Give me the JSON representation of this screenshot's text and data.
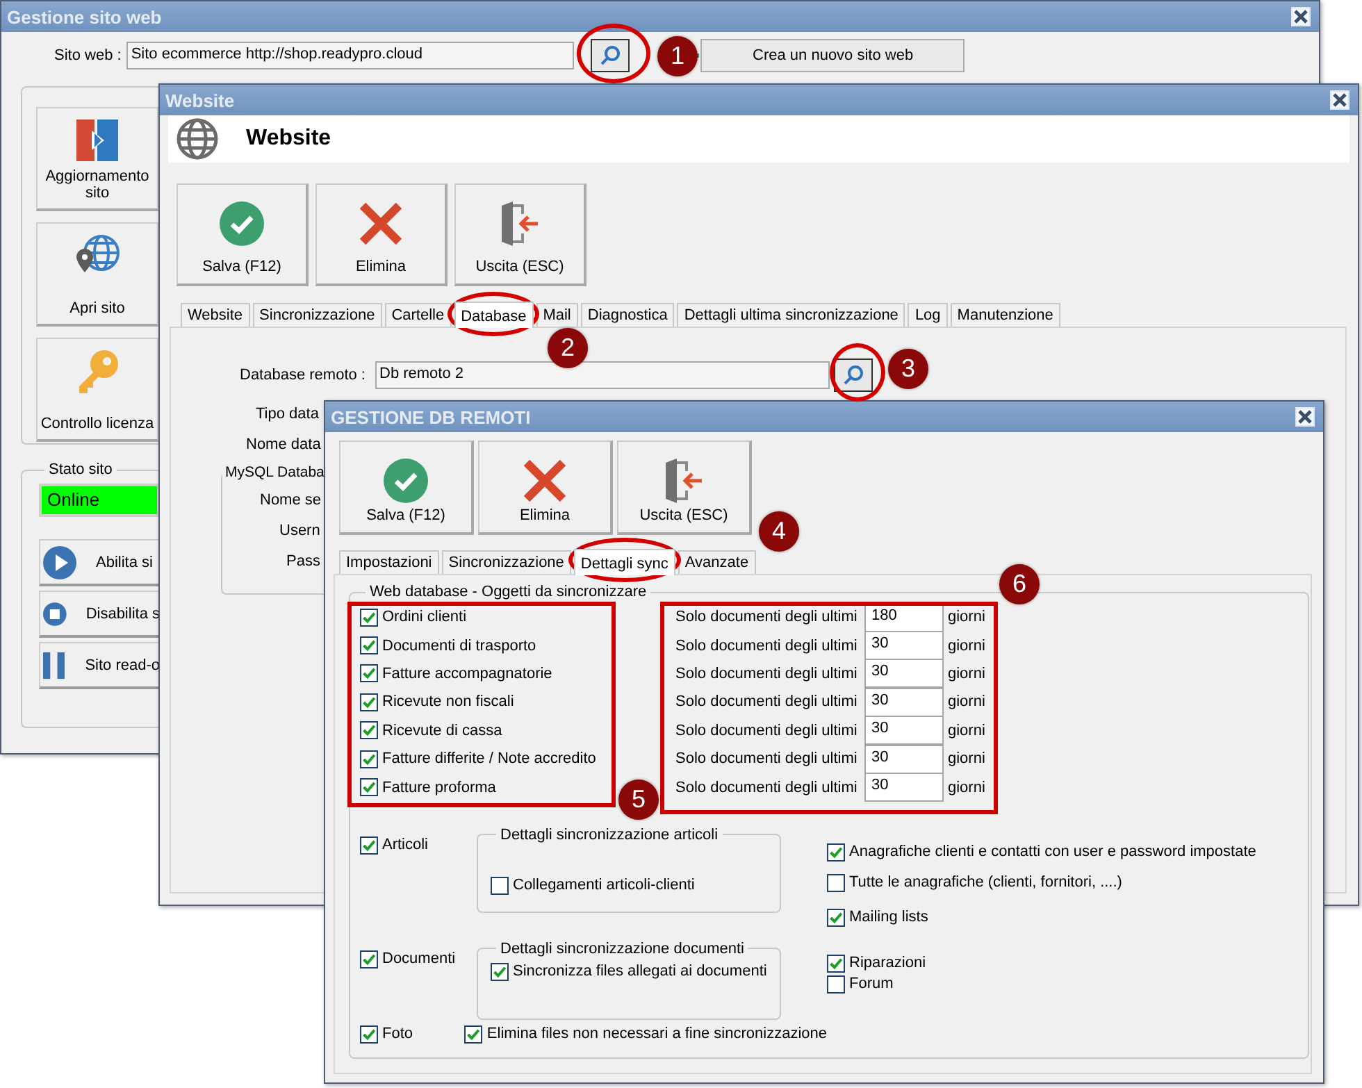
{
  "site_window": {
    "title": "Gestione sito web",
    "site_label": "Sito web :",
    "site_value": "Sito ecommerce http://shop.readypro.cloud",
    "new_site_button": "Crea un nuovo sito web",
    "actions": [
      {
        "kind": "update",
        "label": "Aggiornamento sito"
      },
      {
        "kind": "open",
        "label": "Apri sito"
      },
      {
        "kind": "license",
        "label": "Controllo licenza"
      }
    ],
    "status_group": {
      "title": "Stato sito",
      "status": "Online",
      "buttons": [
        {
          "kind": "play",
          "label": "Abilita si"
        },
        {
          "kind": "stop",
          "label": "Disabilita s"
        },
        {
          "kind": "pause",
          "label": "Sito read-o"
        }
      ]
    }
  },
  "website_window": {
    "title": "Website",
    "heading": "Website",
    "toolbar": [
      {
        "kind": "save",
        "label": "Salva (F12)"
      },
      {
        "kind": "delete",
        "label": "Elimina"
      },
      {
        "kind": "exit",
        "label": "Uscita (ESC)"
      }
    ],
    "tabs": [
      {
        "label": "Website",
        "selected": false
      },
      {
        "label": "Sincronizzazione",
        "selected": false
      },
      {
        "label": "Cartelle",
        "selected": false
      },
      {
        "label": "Database",
        "selected": true
      },
      {
        "label": "Mail",
        "selected": false
      },
      {
        "label": "Diagnostica",
        "selected": false
      },
      {
        "label": "Dettagli ultima sincronizzazione",
        "selected": false
      },
      {
        "label": "Log",
        "selected": false
      },
      {
        "label": "Manutenzione",
        "selected": false
      }
    ],
    "remote_db": {
      "label": "Database remoto :",
      "value": "Db remoto 2"
    },
    "fields": [
      {
        "label": "Tipo data"
      },
      {
        "label": "Nome data"
      }
    ],
    "mysql_group": {
      "title": "MySQL Databa",
      "labels": [
        "Nome se",
        "Usern",
        "Pass"
      ]
    }
  },
  "db_window": {
    "title": "GESTIONE DB REMOTI",
    "toolbar": [
      {
        "kind": "save",
        "label": "Salva (F12)"
      },
      {
        "kind": "delete",
        "label": "Elimina"
      },
      {
        "kind": "exit",
        "label": "Uscita (ESC)"
      }
    ],
    "tabs": [
      {
        "label": "Impostazioni",
        "selected": false
      },
      {
        "label": "Sincronizzazione",
        "selected": false
      },
      {
        "label": "Dettagli sync",
        "selected": true
      },
      {
        "label": "Avanzate",
        "selected": false
      }
    ],
    "group_title": "Web database - Oggetti da sincronizzare",
    "objects": [
      {
        "label": "Ordini clienti",
        "checked": true
      },
      {
        "label": "Documenti di trasporto",
        "checked": true
      },
      {
        "label": "Fatture accompagnatorie",
        "checked": true
      },
      {
        "label": "Ricevute non fiscali",
        "checked": true
      },
      {
        "label": "Ricevute di cassa",
        "checked": true
      },
      {
        "label": "Fatture differite / Note accredito",
        "checked": true
      },
      {
        "label": "Fatture proforma",
        "checked": true
      }
    ],
    "periods": [
      {
        "label": "Solo documenti degli ultimi",
        "value": "180",
        "unit": "giorni"
      },
      {
        "label": "Solo documenti degli ultimi",
        "value": "30",
        "unit": "giorni"
      },
      {
        "label": "Solo documenti degli ultimi",
        "value": "30",
        "unit": "giorni"
      },
      {
        "label": "Solo documenti degli ultimi",
        "value": "30",
        "unit": "giorni"
      },
      {
        "label": "Solo documenti degli ultimi",
        "value": "30",
        "unit": "giorni"
      },
      {
        "label": "Solo documenti degli ultimi",
        "value": "30",
        "unit": "giorni"
      },
      {
        "label": "Solo documenti degli ultimi",
        "value": "30",
        "unit": "giorni"
      }
    ],
    "sections": [
      {
        "label": "Articoli",
        "checked": true,
        "group": {
          "title": "Dettagli sincronizzazione articoli",
          "options": [
            {
              "label": "Collegamenti articoli-clienti",
              "checked": false
            }
          ]
        }
      },
      {
        "label": "Documenti",
        "checked": true,
        "group": {
          "title": "Dettagli sincronizzazione documenti",
          "options": [
            {
              "label": "Sincronizza files allegati ai documenti",
              "checked": true
            }
          ]
        }
      },
      {
        "label": "Foto",
        "checked": true,
        "options": [
          {
            "label": "Elimina files non necessari a fine sincronizzazione",
            "checked": true
          }
        ]
      }
    ],
    "extras": [
      {
        "label": "Anagrafiche clienti e contatti con user e password impostate",
        "checked": true
      },
      {
        "label": "Tutte le anagrafiche (clienti, fornitori, ....)",
        "checked": false
      },
      {
        "label": "Mailing lists",
        "checked": true
      },
      {
        "label": "Riparazioni",
        "checked": true
      },
      {
        "label": "Forum",
        "checked": false
      }
    ]
  },
  "callouts": [
    "1",
    "2",
    "3",
    "4",
    "5",
    "6"
  ]
}
